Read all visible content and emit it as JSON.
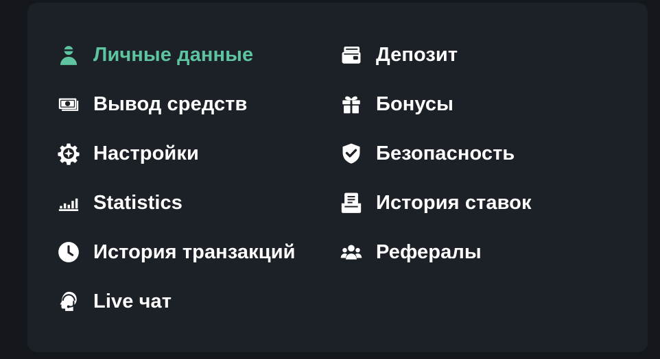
{
  "theme": {
    "background": "#14171c",
    "panel": "#1c2127",
    "text": "#ffffff",
    "accent": "#5ec49f"
  },
  "menu": {
    "items": [
      {
        "label": "Личные данные",
        "icon": "user-icon",
        "active": true
      },
      {
        "label": "Депозит",
        "icon": "wallet-card-icon",
        "active": false
      },
      {
        "label": "Вывод средств",
        "icon": "cash-icon",
        "active": false
      },
      {
        "label": "Бонусы",
        "icon": "gift-icon",
        "active": false
      },
      {
        "label": "Настройки",
        "icon": "gear-icon",
        "active": false
      },
      {
        "label": "Безопасность",
        "icon": "shield-check-icon",
        "active": false
      },
      {
        "label": "Statistics",
        "icon": "bar-chart-icon",
        "active": false
      },
      {
        "label": "История ставок",
        "icon": "bet-slip-icon",
        "active": false
      },
      {
        "label": "История транзакций",
        "icon": "clock-icon",
        "active": false
      },
      {
        "label": "Рефералы",
        "icon": "users-group-icon",
        "active": false
      },
      {
        "label": "Live чат",
        "icon": "support-agent-icon",
        "active": false
      }
    ]
  }
}
